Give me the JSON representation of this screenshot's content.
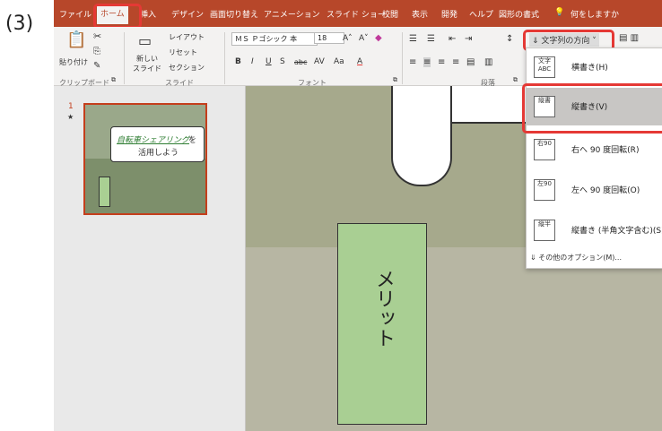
{
  "step_label": "(3)",
  "tabs": {
    "file": "ファイル",
    "home": "ホーム",
    "insert": "挿入",
    "design": "デザイン",
    "transitions": "画面切り替え",
    "animations": "アニメーション",
    "slideshow": "スライド ショー",
    "review": "校閲",
    "view": "表示",
    "developer": "開発",
    "help": "ヘルプ",
    "shape_format": "図形の書式",
    "tell_me": "何をしますか"
  },
  "ribbon": {
    "paste": "貼り付け",
    "clipboard": "クリップボード",
    "new_slide_1": "新しい",
    "new_slide_2": "スライド",
    "layout": "レイアウト",
    "reset": "リセット",
    "section": "セクション",
    "slides_group": "スライド",
    "font_name": "ＭＳ Ｐゴシック 本",
    "font_size": "18",
    "font_group": "フォント",
    "paragraph_group": "段落",
    "text_direction": "文字列の方向"
  },
  "thumbnail": {
    "number": "1",
    "star": "★",
    "title_1": "自転車シェアリング",
    "title_2": "を",
    "title_3": "活用しよう"
  },
  "slide": {
    "merit_text": "メリット"
  },
  "dropdown": {
    "items": [
      {
        "icon": "文字\nABC",
        "label": "横書き(H)"
      },
      {
        "icon": "縦書",
        "label": "縦書き(V)"
      },
      {
        "icon": "右90",
        "label": "右へ 90 度回転(R)"
      },
      {
        "icon": "左90",
        "label": "左へ 90 度回転(O)"
      },
      {
        "icon": "縦半",
        "label": "縦書き (半角文字含む)(S)"
      }
    ],
    "more_options": "その他のオプション(M)..."
  },
  "colors": {
    "accent": "#b7472a",
    "highlight": "#e53935",
    "merit_fill": "#a9cf93"
  }
}
